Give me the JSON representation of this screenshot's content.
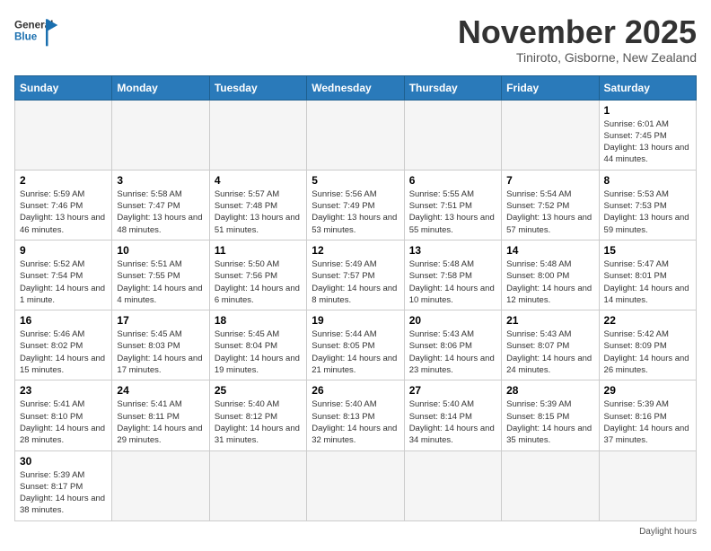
{
  "header": {
    "logo_general": "General",
    "logo_blue": "Blue",
    "month_title": "November 2025",
    "location": "Tiniroto, Gisborne, New Zealand"
  },
  "weekdays": [
    "Sunday",
    "Monday",
    "Tuesday",
    "Wednesday",
    "Thursday",
    "Friday",
    "Saturday"
  ],
  "footer": "Daylight hours",
  "weeks": [
    [
      {
        "day": "",
        "info": ""
      },
      {
        "day": "",
        "info": ""
      },
      {
        "day": "",
        "info": ""
      },
      {
        "day": "",
        "info": ""
      },
      {
        "day": "",
        "info": ""
      },
      {
        "day": "",
        "info": ""
      },
      {
        "day": "1",
        "info": "Sunrise: 6:01 AM\nSunset: 7:45 PM\nDaylight: 13 hours and 44 minutes."
      }
    ],
    [
      {
        "day": "2",
        "info": "Sunrise: 5:59 AM\nSunset: 7:46 PM\nDaylight: 13 hours and 46 minutes."
      },
      {
        "day": "3",
        "info": "Sunrise: 5:58 AM\nSunset: 7:47 PM\nDaylight: 13 hours and 48 minutes."
      },
      {
        "day": "4",
        "info": "Sunrise: 5:57 AM\nSunset: 7:48 PM\nDaylight: 13 hours and 51 minutes."
      },
      {
        "day": "5",
        "info": "Sunrise: 5:56 AM\nSunset: 7:49 PM\nDaylight: 13 hours and 53 minutes."
      },
      {
        "day": "6",
        "info": "Sunrise: 5:55 AM\nSunset: 7:51 PM\nDaylight: 13 hours and 55 minutes."
      },
      {
        "day": "7",
        "info": "Sunrise: 5:54 AM\nSunset: 7:52 PM\nDaylight: 13 hours and 57 minutes."
      },
      {
        "day": "8",
        "info": "Sunrise: 5:53 AM\nSunset: 7:53 PM\nDaylight: 13 hours and 59 minutes."
      }
    ],
    [
      {
        "day": "9",
        "info": "Sunrise: 5:52 AM\nSunset: 7:54 PM\nDaylight: 14 hours and 1 minute."
      },
      {
        "day": "10",
        "info": "Sunrise: 5:51 AM\nSunset: 7:55 PM\nDaylight: 14 hours and 4 minutes."
      },
      {
        "day": "11",
        "info": "Sunrise: 5:50 AM\nSunset: 7:56 PM\nDaylight: 14 hours and 6 minutes."
      },
      {
        "day": "12",
        "info": "Sunrise: 5:49 AM\nSunset: 7:57 PM\nDaylight: 14 hours and 8 minutes."
      },
      {
        "day": "13",
        "info": "Sunrise: 5:48 AM\nSunset: 7:58 PM\nDaylight: 14 hours and 10 minutes."
      },
      {
        "day": "14",
        "info": "Sunrise: 5:48 AM\nSunset: 8:00 PM\nDaylight: 14 hours and 12 minutes."
      },
      {
        "day": "15",
        "info": "Sunrise: 5:47 AM\nSunset: 8:01 PM\nDaylight: 14 hours and 14 minutes."
      }
    ],
    [
      {
        "day": "16",
        "info": "Sunrise: 5:46 AM\nSunset: 8:02 PM\nDaylight: 14 hours and 15 minutes."
      },
      {
        "day": "17",
        "info": "Sunrise: 5:45 AM\nSunset: 8:03 PM\nDaylight: 14 hours and 17 minutes."
      },
      {
        "day": "18",
        "info": "Sunrise: 5:45 AM\nSunset: 8:04 PM\nDaylight: 14 hours and 19 minutes."
      },
      {
        "day": "19",
        "info": "Sunrise: 5:44 AM\nSunset: 8:05 PM\nDaylight: 14 hours and 21 minutes."
      },
      {
        "day": "20",
        "info": "Sunrise: 5:43 AM\nSunset: 8:06 PM\nDaylight: 14 hours and 23 minutes."
      },
      {
        "day": "21",
        "info": "Sunrise: 5:43 AM\nSunset: 8:07 PM\nDaylight: 14 hours and 24 minutes."
      },
      {
        "day": "22",
        "info": "Sunrise: 5:42 AM\nSunset: 8:09 PM\nDaylight: 14 hours and 26 minutes."
      }
    ],
    [
      {
        "day": "23",
        "info": "Sunrise: 5:41 AM\nSunset: 8:10 PM\nDaylight: 14 hours and 28 minutes."
      },
      {
        "day": "24",
        "info": "Sunrise: 5:41 AM\nSunset: 8:11 PM\nDaylight: 14 hours and 29 minutes."
      },
      {
        "day": "25",
        "info": "Sunrise: 5:40 AM\nSunset: 8:12 PM\nDaylight: 14 hours and 31 minutes."
      },
      {
        "day": "26",
        "info": "Sunrise: 5:40 AM\nSunset: 8:13 PM\nDaylight: 14 hours and 32 minutes."
      },
      {
        "day": "27",
        "info": "Sunrise: 5:40 AM\nSunset: 8:14 PM\nDaylight: 14 hours and 34 minutes."
      },
      {
        "day": "28",
        "info": "Sunrise: 5:39 AM\nSunset: 8:15 PM\nDaylight: 14 hours and 35 minutes."
      },
      {
        "day": "29",
        "info": "Sunrise: 5:39 AM\nSunset: 8:16 PM\nDaylight: 14 hours and 37 minutes."
      }
    ],
    [
      {
        "day": "30",
        "info": "Sunrise: 5:39 AM\nSunset: 8:17 PM\nDaylight: 14 hours and 38 minutes."
      },
      {
        "day": "",
        "info": ""
      },
      {
        "day": "",
        "info": ""
      },
      {
        "day": "",
        "info": ""
      },
      {
        "day": "",
        "info": ""
      },
      {
        "day": "",
        "info": ""
      },
      {
        "day": "",
        "info": ""
      }
    ]
  ]
}
